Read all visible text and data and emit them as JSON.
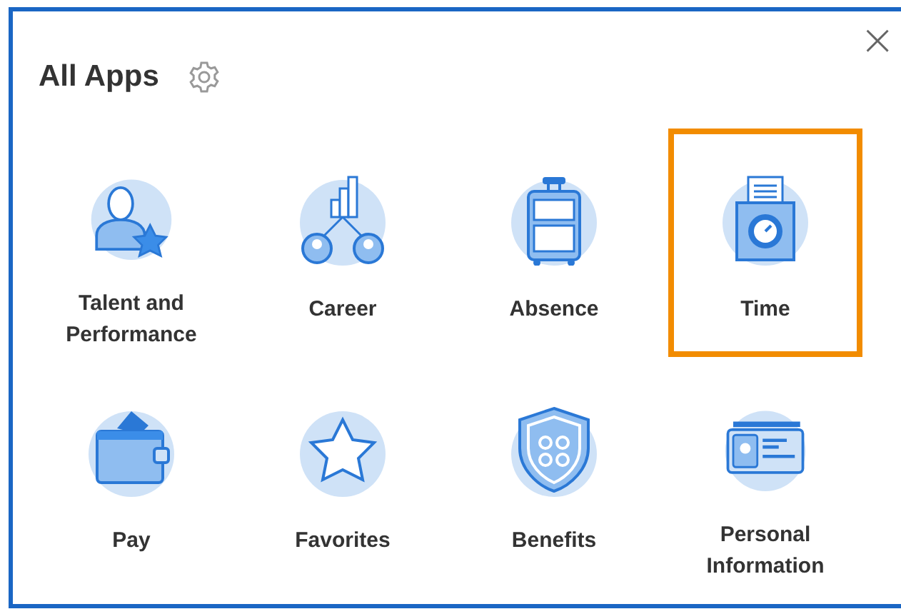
{
  "dialog": {
    "title": "All Apps",
    "close": "×"
  },
  "apps": [
    {
      "kind": "talent",
      "label": "Talent and Performance",
      "highlighted": false
    },
    {
      "kind": "career",
      "label": "Career",
      "highlighted": false
    },
    {
      "kind": "absence",
      "label": "Absence",
      "highlighted": false
    },
    {
      "kind": "time",
      "label": "Time",
      "highlighted": true
    },
    {
      "kind": "pay",
      "label": "Pay",
      "highlighted": false
    },
    {
      "kind": "favorites",
      "label": "Favorites",
      "highlighted": false
    },
    {
      "kind": "benefits",
      "label": "Benefits",
      "highlighted": false
    },
    {
      "kind": "personal",
      "label": "Personal Information",
      "highlighted": false
    }
  ]
}
